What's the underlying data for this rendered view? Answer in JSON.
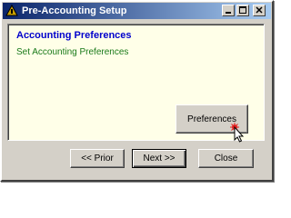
{
  "window": {
    "title": "Pre-Accounting Setup",
    "title_buttons": [
      "minimize",
      "maximize",
      "close"
    ]
  },
  "content": {
    "heading": "Accounting Preferences",
    "subheading": "Set Accounting Preferences",
    "preferences_button": "Preferences"
  },
  "footer": {
    "prior_label": "<< Prior",
    "next_label": "Next >>",
    "close_label": "Close"
  },
  "colors": {
    "title_gradient_start": "#0a246a",
    "title_gradient_end": "#a6caf0",
    "heading": "#0000cc",
    "subheading": "#1a7a1a",
    "content_bg": "#ffffe8",
    "chrome": "#d4d0c8",
    "click_marker": "#e52020"
  },
  "icons": {
    "app": "accounting-app-icon",
    "cursor": "arrow-cursor-icon",
    "click": "click-burst-icon"
  }
}
